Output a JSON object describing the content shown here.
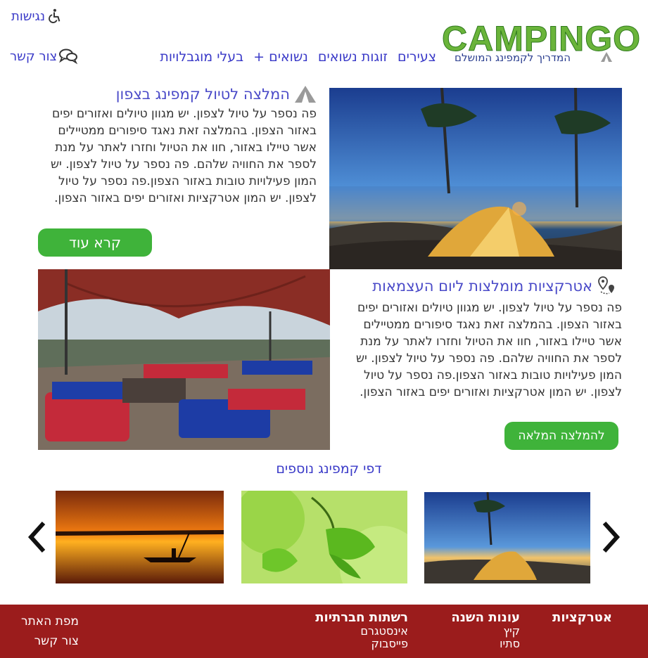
{
  "header": {
    "logo_text": "CAMPINGO",
    "tagline": "המדריך לקמפינג המושלם",
    "accessibility_label": "נגישות",
    "nav_items": [
      {
        "label": "צעירים"
      },
      {
        "label": "זוגות נשואים"
      },
      {
        "label": "נשואים +"
      },
      {
        "label": "בעלי מוגבלויות"
      }
    ],
    "contact_label": "צור קשר"
  },
  "article1": {
    "title": "המלצה לטיול קמפינג בצפון",
    "body": "פה נספר על טיול לצפון. יש מגוון טיולים ואזורים יפים באזור הצפון. בהמלצה זאת נאגד סיפורים ממטיילים אשר טיילו באזור, חוו את הטיול וחזרו לאתר על מנת לספר את החוויה שלהם. פה נספר על טיול לצפון. יש המון פעילויות טובות באזור הצפון.פה נספר על טיול לצפון. יש המון אטרקציות ואזורים יפים באזור הצפון.",
    "button_label": "קרא עוד"
  },
  "article2": {
    "title": "אטרקציות מומלצות ליום העצמאות",
    "body": "פה נספר על טיול לצפון. יש מגוון טיולים ואזורים יפים באזור הצפון. בהמלצה זאת נאגד סיפורים ממטיילים אשר טיילו באזור, חוו את הטיול וחזרו לאתר על מנת לספר את החוויה שלהם. פה נספר על טיול לצפון. יש המון פעילויות טובות באזור הצפון.פה נספר על טיול לצפון. יש המון אטרקציות ואזורים יפים באזור הצפון.",
    "button_label": "להמלצה המלאה"
  },
  "gallery": {
    "title": "דפי קמפינג נוספים",
    "prev_icon": "‹",
    "next_icon": "›"
  },
  "footer": {
    "attractions": {
      "heading": "אטרקציות"
    },
    "seasons": {
      "heading": "עונות השנה",
      "links": [
        "קיץ",
        "סתיו"
      ]
    },
    "social": {
      "heading": "רשתות חברתיות",
      "links": [
        "אינסטגרם",
        "פייסבוק"
      ]
    },
    "site": {
      "links": [
        "מפת האתר",
        "צור קשר"
      ]
    }
  },
  "colors": {
    "nav_blue": "#3a3ac8",
    "button_green": "#3fb33a",
    "footer_red": "#9b1c1c",
    "logo_green": "#6ab43a"
  }
}
